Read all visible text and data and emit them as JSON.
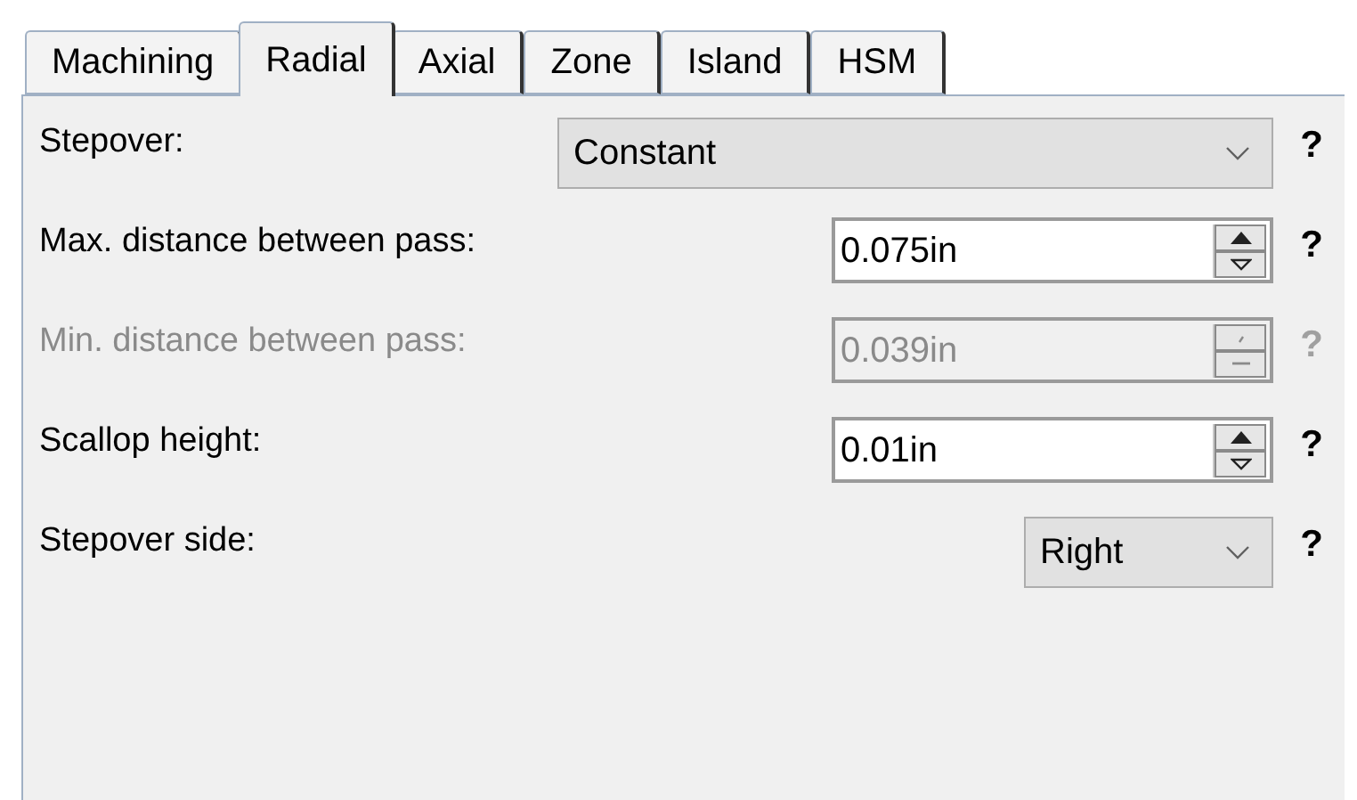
{
  "tabs": [
    {
      "label": "Machining",
      "selected": false
    },
    {
      "label": "Radial",
      "selected": true
    },
    {
      "label": "Axial",
      "selected": false
    },
    {
      "label": "Zone",
      "selected": false
    },
    {
      "label": "Island",
      "selected": false
    },
    {
      "label": "HSM",
      "selected": false
    }
  ],
  "rows": [
    {
      "kind": "dropdown",
      "label": "Stepover:",
      "value": "Constant",
      "disabled": false,
      "help": "?"
    },
    {
      "kind": "spin",
      "label": "Max. distance between pass:",
      "value": "0.075in",
      "disabled": false,
      "help": "?"
    },
    {
      "kind": "spin",
      "label": "Min. distance between pass:",
      "value": "0.039in",
      "disabled": true,
      "help": "?"
    },
    {
      "kind": "spin",
      "label": "Scallop height:",
      "value": "0.01in",
      "disabled": false,
      "help": "?"
    },
    {
      "kind": "compact-dropdown",
      "label": "Stepover side:",
      "value": "Right",
      "disabled": false,
      "help": "?"
    }
  ]
}
